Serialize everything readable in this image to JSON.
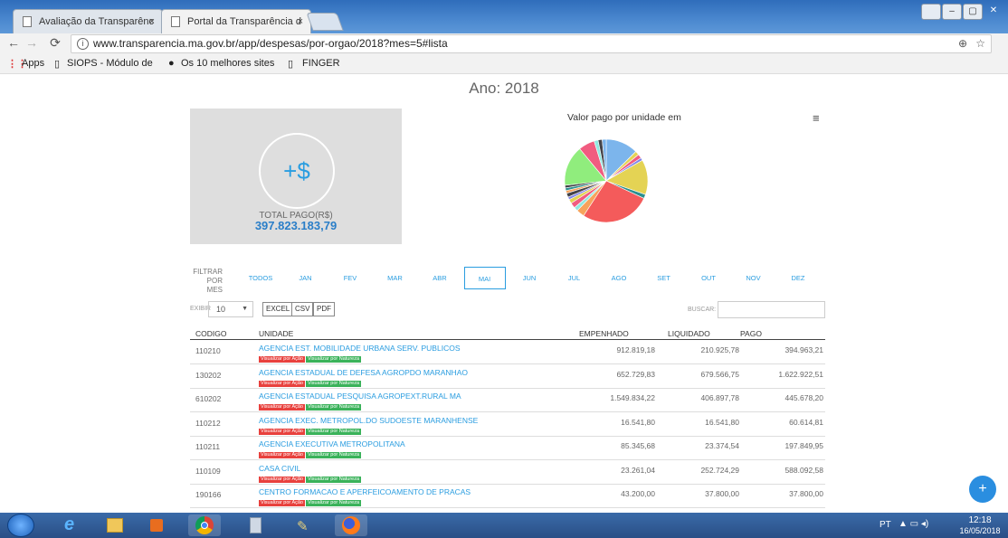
{
  "browser": {
    "tabs": [
      {
        "label": "Avaliação da Transparênc"
      },
      {
        "label": "Portal da Transparência d"
      }
    ],
    "tab_close": "×",
    "url": "www.transparencia.ma.gov.br/app/despesas/por-orgao/2018?mes=5#lista",
    "bookmarks": [
      "Apps",
      "SIOPS - Módulo de",
      "Os 10 melhores sites",
      "FINGER"
    ],
    "window_buttons": [
      "–",
      "▢",
      "✕"
    ]
  },
  "page": {
    "title": "Ano: 2018",
    "total_symbol": "+$",
    "total_label": "TOTAL PAGO(R$)",
    "total_value": "397.823.183,79",
    "chart_title": "Valor pago por unidade em",
    "chart_menu": "≡"
  },
  "chart_data": {
    "type": "pie",
    "title": "Valor pago por unidade em",
    "slices": [
      {
        "value": 12,
        "color": "#7cb5ec"
      },
      {
        "value": 1.5,
        "color": "#e4d354"
      },
      {
        "value": 1.5,
        "color": "#f15c80"
      },
      {
        "value": 1,
        "color": "#8085e9"
      },
      {
        "value": 13,
        "color": "#e4d354"
      },
      {
        "value": 1.5,
        "color": "#2b908f"
      },
      {
        "value": 26,
        "color": "#f45b5b"
      },
      {
        "value": 3,
        "color": "#f7a35c"
      },
      {
        "value": 1.5,
        "color": "#91e8e1"
      },
      {
        "value": 2,
        "color": "#f15c80"
      },
      {
        "value": 1.5,
        "color": "#e4d354"
      },
      {
        "value": 1,
        "color": "#8085e9"
      },
      {
        "value": 1.5,
        "color": "#434348"
      },
      {
        "value": 1,
        "color": "#f7a35c"
      },
      {
        "value": 1,
        "color": "#2b908f"
      },
      {
        "value": 1,
        "color": "#434348"
      },
      {
        "value": 15,
        "color": "#90ed7d"
      },
      {
        "value": 6,
        "color": "#f15c80"
      },
      {
        "value": 1.5,
        "color": "#91e8e1"
      },
      {
        "value": 1.5,
        "color": "#434348"
      },
      {
        "value": 1.5,
        "color": "#7cb5ec"
      }
    ]
  },
  "filter": {
    "label": "FILTRAR POR MES",
    "months": [
      "TODOS",
      "JAN",
      "FEV",
      "MAR",
      "ABR",
      "MAI",
      "JUN",
      "JUL",
      "AGO",
      "SET",
      "OUT",
      "NOV",
      "DEZ"
    ],
    "active": "MAI"
  },
  "controls": {
    "show_label": "EXIBIR",
    "show_value": "10",
    "show_arrow": "▼",
    "export": [
      "EXCEL",
      "CSV",
      "PDF"
    ],
    "search_label": "BUSCAR:"
  },
  "table": {
    "headers": {
      "code": "CODIGO",
      "unit": "UNIDADE",
      "empenhado": "EMPENHADO",
      "liquidado": "LIQUIDADO",
      "pago": "PAGO"
    },
    "tag_action": "Visualizar por Ação",
    "tag_nature": "Visualizar por Natureza",
    "rows": [
      {
        "code": "110210",
        "unit": "AGENCIA EST. MOBILIDADE URBANA SERV. PUBLICOS",
        "empenhado": "912.819,18",
        "liquidado": "210.925,78",
        "pago": "394.963,21"
      },
      {
        "code": "130202",
        "unit": "AGENCIA ESTADUAL DE DEFESA AGROPDO MARANHAO",
        "empenhado": "652.729,83",
        "liquidado": "679.566,75",
        "pago": "1.622.922,51"
      },
      {
        "code": "610202",
        "unit": "AGENCIA ESTADUAL PESQUISA AGROPEXT.RURAL MA",
        "empenhado": "1.549.834,22",
        "liquidado": "406.897,78",
        "pago": "445.678,20"
      },
      {
        "code": "110212",
        "unit": "AGENCIA EXEC. METROPOL.DO SUDOESTE MARANHENSE",
        "empenhado": "16.541,80",
        "liquidado": "16.541,80",
        "pago": "60.614,81"
      },
      {
        "code": "110211",
        "unit": "AGENCIA EXECUTIVA METROPOLITANA",
        "empenhado": "85.345,68",
        "liquidado": "23.374,54",
        "pago": "197.849,95"
      },
      {
        "code": "110109",
        "unit": "CASA CIVIL",
        "empenhado": "23.261,04",
        "liquidado": "252.724,29",
        "pago": "588.092,58"
      },
      {
        "code": "190166",
        "unit": "CENTRO FORMACAO E APERFEICOAMENTO DE PRACAS",
        "empenhado": "43.200,00",
        "liquidado": "37.800,00",
        "pago": "37.800,00"
      }
    ]
  },
  "fab_label": "+",
  "taskbar": {
    "lang": "PT",
    "tray": "▲ ▭ ◂)",
    "time": "12:18",
    "date": "16/05/2018"
  }
}
